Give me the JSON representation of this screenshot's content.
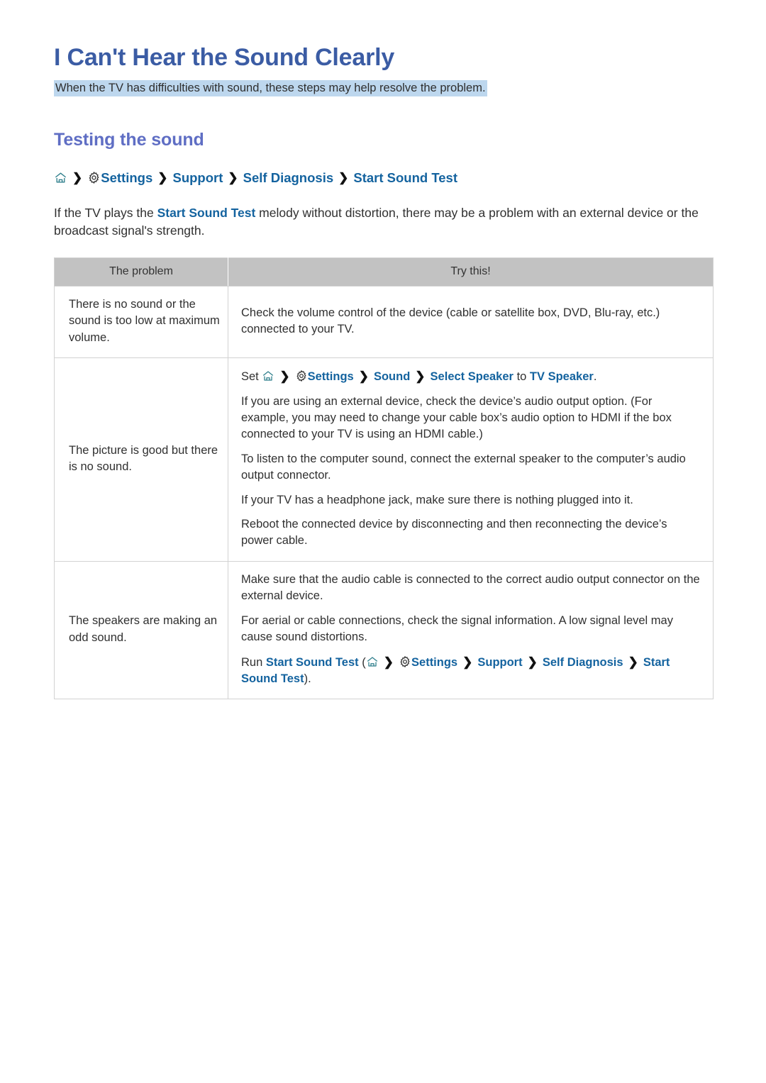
{
  "document": {
    "title": "I Can't Hear the Sound Clearly",
    "subtitle": "When the TV has difficulties with sound, these steps may help resolve the problem.",
    "section_heading": "Testing the sound"
  },
  "colors": {
    "title": "#3b5ca4",
    "section_heading": "#5f6ec4",
    "link": "#14639f",
    "highlight": "#bdd7ee",
    "table_header_bg": "#c2c2c2",
    "home_icon": "#2f7f8c"
  },
  "breadcrumb": {
    "home_icon": "home-icon",
    "gear_icon": "gear-icon",
    "separator": "chevron-right-icon",
    "items": [
      "Settings",
      "Support",
      "Self Diagnosis",
      "Start Sound Test"
    ]
  },
  "intro": {
    "before": "If the TV plays the ",
    "link": "Start Sound Test",
    "after": " melody without distortion, there may be a problem with an external device or the broadcast signal's strength."
  },
  "table": {
    "headers": [
      "The problem",
      "Try this!"
    ],
    "rows": [
      {
        "problem": "There is no sound or the sound is too low at maximum volume.",
        "lines": [
          "Check the volume control of the device (cable or satellite box, DVD, Blu-ray, etc.) connected to your TV."
        ]
      },
      {
        "problem": "The picture is good but there is no sound.",
        "set_line": {
          "prefix": "Set",
          "settings": "Settings",
          "sound": "Sound",
          "select_speaker": "Select Speaker",
          "to": "to",
          "tv_speaker": "TV Speaker",
          "period": "."
        },
        "lines": [
          "If you are using an external device, check the device’s audio output option. (For example, you may need to change your cable box’s audio option to HDMI if the box connected to your TV is using an HDMI cable.)",
          "To listen to the computer sound, connect the external speaker to the computer’s audio output connector.",
          "If your TV has a headphone jack, make sure there is nothing plugged into it.",
          "Reboot the connected device by disconnecting and then reconnecting the device’s power cable."
        ]
      },
      {
        "problem": "The speakers are making an odd sound.",
        "lines": [
          "Make sure that the audio cable is connected to the correct audio output connector on the external device.",
          "For aerial or cable connections, check the signal information. A low signal level may cause sound distortions."
        ],
        "run_line": {
          "prefix": "Run",
          "test_link": "Start Sound Test",
          "open_paren": "(",
          "settings": "Settings",
          "support": "Support",
          "self_diagnosis": "Self Diagnosis",
          "start_sound_test": "Start Sound Test",
          "close_paren": ")",
          "period": "."
        }
      }
    ]
  }
}
